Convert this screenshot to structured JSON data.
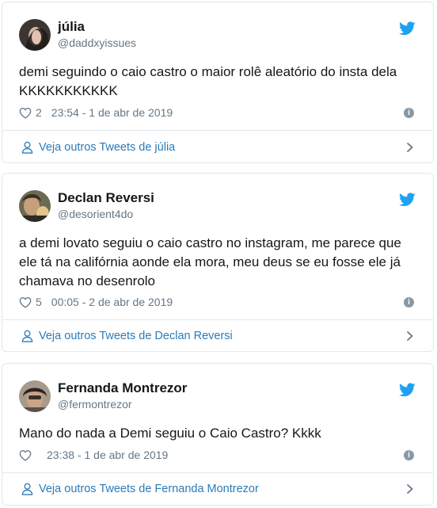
{
  "tweets": [
    {
      "name": "júlia",
      "handle": "@daddxyissues",
      "text": "demi seguindo o caio castro o maior rolê aleatório do insta dela KKKKKKKKKKK",
      "likes": "2",
      "timestamp": "23:54 - 1 de abr de 2019",
      "footer_label": "Veja outros Tweets de júlia"
    },
    {
      "name": "Declan Reversi",
      "handle": "@desorient4do",
      "text": "a demi lovato seguiu o caio castro no instagram, me parece que ele tá na califórnia aonde ela mora, meu deus se eu fosse ele já chamava no desenrolo",
      "likes": "5",
      "timestamp": "00:05 - 2 de abr de 2019",
      "footer_label": "Veja outros Tweets de Declan Reversi"
    },
    {
      "name": "Fernanda Montrezor",
      "handle": "@fermontrezor",
      "text": "Mano do nada a Demi seguiu o Caio Castro? Kkkk",
      "likes": "",
      "timestamp": "23:38 - 1 de abr de 2019",
      "footer_label": "Veja outros Tweets de Fernanda Montrezor"
    }
  ],
  "icons": {
    "bird": "twitter-bird-icon",
    "heart": "heart-icon",
    "info": "info-icon",
    "person": "person-icon",
    "chevron": "chevron-right-icon"
  },
  "colors": {
    "twitter_blue": "#1da1f2",
    "link_blue": "#2b7bb9",
    "muted": "#657786",
    "border": "#e1e8ed"
  }
}
